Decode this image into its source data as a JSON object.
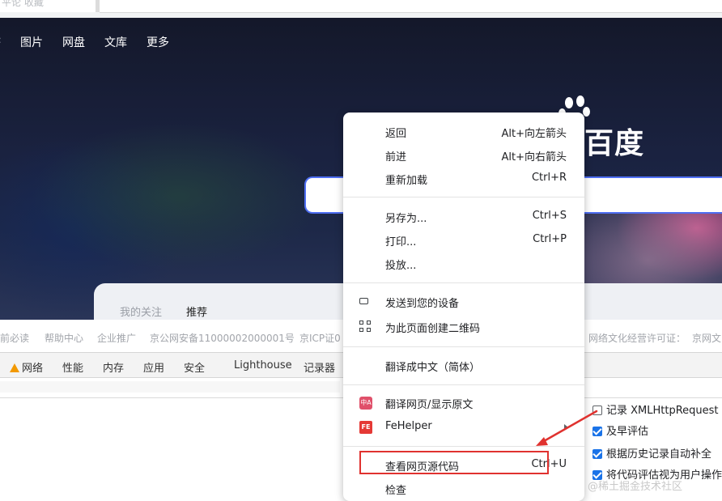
{
  "browser": {
    "tab_text": "平论   收藏"
  },
  "baidu": {
    "nav": [
      "图片",
      "网盘",
      "文库",
      "更多"
    ],
    "logo_text": "百度",
    "panel_tabs": [
      "我的关注",
      "推荐"
    ],
    "footer_links": [
      "前必读",
      "帮助中心",
      "企业推广",
      "京公网安备11000002000001号",
      "京ICP证0",
      "网络文化经营许可证：",
      "京网文"
    ]
  },
  "devtools": {
    "tabs": [
      "网络",
      "性能",
      "内存",
      "应用",
      "安全",
      "Lighthouse",
      "记录器"
    ],
    "settings": [
      {
        "label": "记录 XMLHttpRequest",
        "checked": false
      },
      {
        "label": "及早评估",
        "checked": true
      },
      {
        "label": "根据历史记录自动补全",
        "checked": true
      },
      {
        "label": "将代码评估视为用户操作",
        "checked": true
      }
    ]
  },
  "context_menu": {
    "groups": [
      [
        {
          "label": "返回",
          "shortcut": "Alt+向左箭头"
        },
        {
          "label": "前进",
          "shortcut": "Alt+向右箭头"
        },
        {
          "label": "重新加载",
          "shortcut": "Ctrl+R"
        }
      ],
      [
        {
          "label": "另存为...",
          "shortcut": "Ctrl+S"
        },
        {
          "label": "打印...",
          "shortcut": "Ctrl+P"
        },
        {
          "label": "投放..."
        }
      ],
      [
        {
          "label": "发送到您的设备",
          "icon": "devices-icon"
        },
        {
          "label": "为此页面创建二维码",
          "icon": "qr-code-icon"
        }
      ],
      [
        {
          "label": "翻译成中文（简体）"
        }
      ],
      [
        {
          "label": "翻译网页/显示原文",
          "icon": "translate-extension-icon",
          "icon_text": "中A"
        },
        {
          "label": "FeHelper",
          "icon": "fehelper-icon",
          "icon_text": "FE",
          "submenu": true
        }
      ],
      [
        {
          "label": "查看网页源代码",
          "shortcut": "Ctrl+U",
          "highlighted": true
        },
        {
          "label": "检查"
        }
      ]
    ]
  },
  "annotation": {
    "highlight_color": "#e0322f",
    "arrow_color": "#e0322f"
  },
  "watermark": "@稀土掘金技术社区",
  "colors": {
    "baidu_blue": "#4e6ef2",
    "checkbox_blue": "#1a73e8",
    "warning": "#f29900"
  }
}
